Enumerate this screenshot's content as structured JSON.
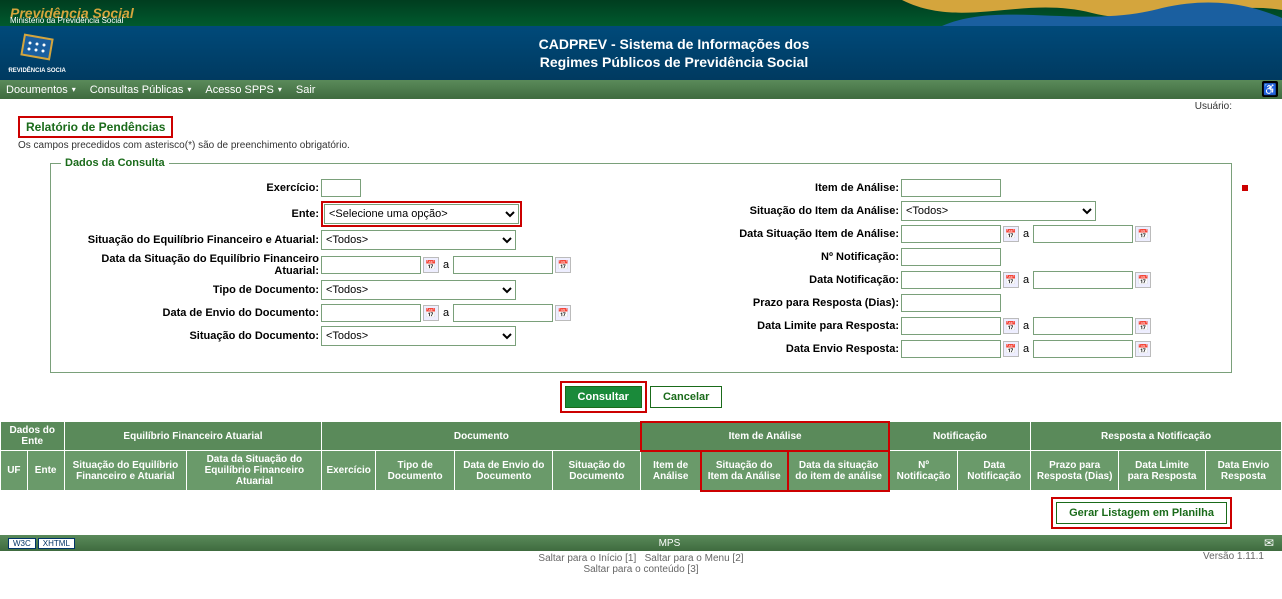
{
  "brand": {
    "title": "Previdência Social",
    "subtitle": "Ministério da Previdência Social",
    "logo_caption": "PREVIDÊNCIA SOCIAL"
  },
  "banner": {
    "line1": "CADPREV - Sistema de Informações dos",
    "line2": "Regimes Públicos de Previdência Social"
  },
  "menu": {
    "documentos": "Documentos",
    "consultas": "Consultas Públicas",
    "acesso": "Acesso SPPS",
    "sair": "Sair"
  },
  "infobar": {
    "usuario_label": "Usuário:",
    "usuario_value": ""
  },
  "page": {
    "title": "Relatório de Pendências",
    "hint": "Os campos precedidos com asterisco(*) são de preenchimento obrigatório."
  },
  "fieldset": {
    "legend": "Dados da Consulta"
  },
  "labels": {
    "exercicio": "Exercício:",
    "ente": "Ente:",
    "sit_equilibrio": "Situação do Equilíbrio Financeiro e Atuarial:",
    "data_sit_equilibrio": "Data da Situação do Equilíbrio Financeiro Atuarial:",
    "tipo_documento": "Tipo de Documento:",
    "data_envio_doc": "Data de Envio do Documento:",
    "sit_documento": "Situação do Documento:",
    "item_analise": "Item de Análise:",
    "sit_item_analise": "Situação do Item da Análise:",
    "data_sit_item": "Data Situação Item de Análise:",
    "num_notificacao": "Nº Notificação:",
    "data_notificacao": "Data Notificação:",
    "prazo_resposta": "Prazo para Resposta (Dias):",
    "data_limite_resposta": "Data Limite para Resposta:",
    "data_envio_resposta": "Data Envio Resposta:"
  },
  "options": {
    "selecione": "<Selecione uma opção>",
    "todos": "<Todos>"
  },
  "range_sep": "a",
  "buttons": {
    "consultar": "Consultar",
    "cancelar": "Cancelar",
    "gerar_planilha": "Gerar Listagem em Planilha"
  },
  "table": {
    "groups": {
      "dados_ente": "Dados do Ente",
      "equilibrio": "Equilíbrio Financeiro Atuarial",
      "documento": "Documento",
      "item_analise": "Item de Análise",
      "notificacao": "Notificação",
      "resposta": "Resposta a Notificação"
    },
    "cols": {
      "uf": "UF",
      "ente": "Ente",
      "sit_equilibrio": "Situação do Equilíbrio Financeiro e Atuarial",
      "data_sit_equilibrio": "Data da Situação do Equilíbrio Financeiro Atuarial",
      "exercicio": "Exercício",
      "tipo_doc": "Tipo de Documento",
      "data_envio_doc": "Data de Envio do Documento",
      "sit_doc": "Situação do Documento",
      "item_analise": "Item de Análise",
      "sit_item": "Situação do Item da Análise",
      "data_sit_item": "Data da situação do item de análise",
      "num_notif": "Nº Notificação",
      "data_notif": "Data Notificação",
      "prazo": "Prazo para Resposta (Dias)",
      "data_limite": "Data Limite para Resposta",
      "data_envio_resp": "Data Envio Resposta"
    }
  },
  "footer": {
    "badge1": "W3C",
    "badge2": "XHTML",
    "center": "MPS",
    "link1": "Saltar para o Início [1]",
    "link2": "Saltar para o Menu [2]",
    "link3": "Saltar para o conteúdo [3]",
    "version": "Versão 1.11.1"
  }
}
